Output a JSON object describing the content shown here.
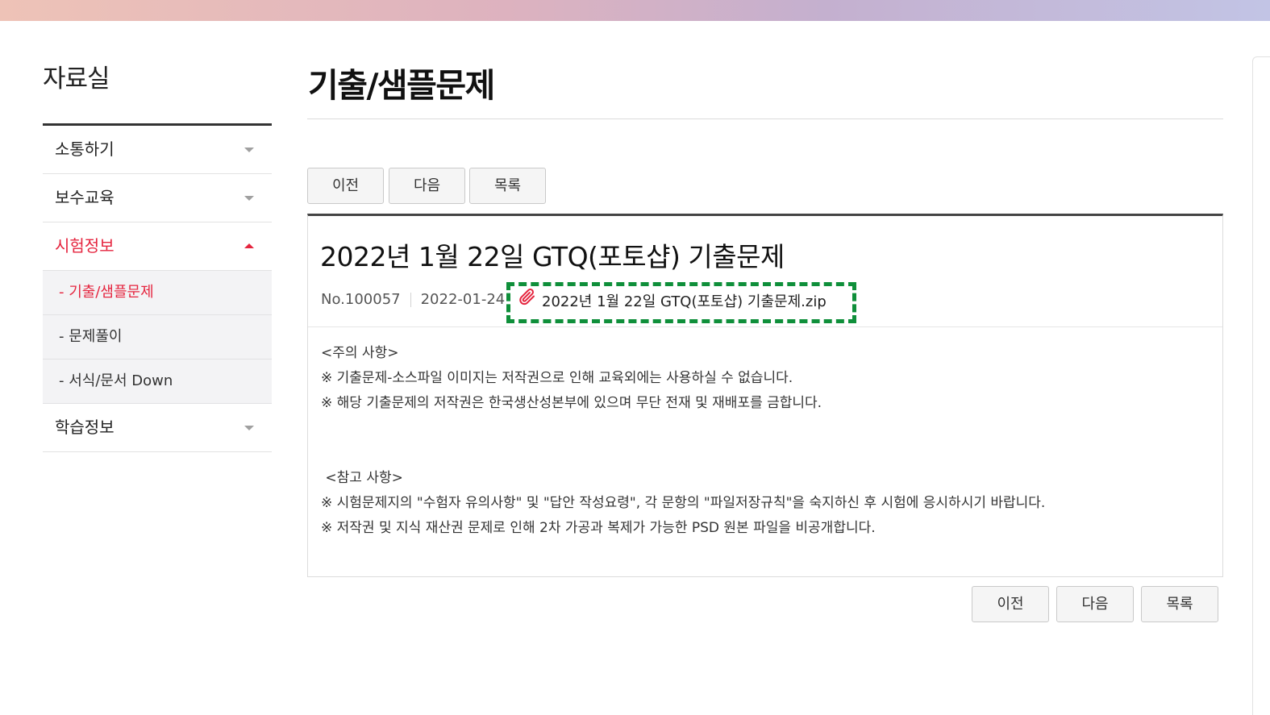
{
  "sidebar": {
    "title": "자료실",
    "items": [
      {
        "label": "소통하기"
      },
      {
        "label": "보수교육"
      },
      {
        "label": "시험정보",
        "active": true
      },
      {
        "label": "학습정보"
      }
    ],
    "sub_items": [
      {
        "label": "- 기출/샘플문제",
        "active": true
      },
      {
        "label": "- 문제풀이"
      },
      {
        "label": "- 서식/문서 Down"
      }
    ]
  },
  "main": {
    "page_title": "기출/샘플문제",
    "buttons": {
      "prev": "이전",
      "next": "다음",
      "list": "목록"
    }
  },
  "post": {
    "title": "2022년 1월 22일 GTQ(포토샵) 기출문제",
    "number": "No.100057",
    "date": "2022-01-24",
    "attachment": "2022년 1월 22일 GTQ(포토샵) 기출문제.zip",
    "body": [
      "<주의 사항>",
      "※ 기출문제-소스파일 이미지는 저작권으로 인해 교육외에는 사용하실 수 없습니다.",
      "※ 해당 기출문제의 저작권은 한국생산성본부에 있으며 무단 전재 및 재배포를 금합니다.",
      " <참고 사항>",
      "※ 시험문제지의 \"수험자 유의사항\" 및 \"답안 작성요령\", 각 문항의 \"파일저장규칙\"을 숙지하신 후 시험에 응시하시기 바랍니다.",
      "※ 저작권 및 지식 재산권 문제로 인해 2차 가공과 복제가 가능한 PSD 원본 파일을 비공개합니다."
    ]
  },
  "colors": {
    "accent": "#e5253f",
    "highlight": "#0f8f3a"
  }
}
